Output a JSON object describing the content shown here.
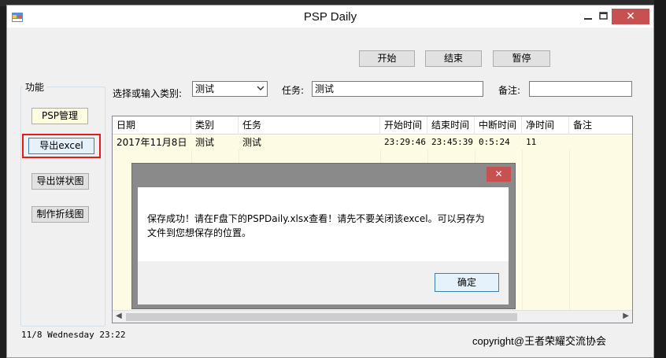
{
  "window": {
    "title": "PSP Daily",
    "close_glyph": "✕"
  },
  "toolbar": {
    "start": "开始",
    "end": "结束",
    "pause": "暂停"
  },
  "sidebar": {
    "group_title": "功能",
    "psp_manage": "PSP管理",
    "export_excel": "导出excel",
    "export_pie": "导出饼状图",
    "make_line": "制作折线图"
  },
  "form": {
    "category_label": "选择或输入类别:",
    "category_value": "测试",
    "task_label": "任务:",
    "task_value": "测试",
    "note_label": "备注:",
    "note_value": ""
  },
  "grid": {
    "columns": [
      "日期",
      "类别",
      "任务",
      "开始时间",
      "结束时间",
      "中断时间",
      "净时间",
      "备注"
    ],
    "rows": [
      [
        "2017年11月8日",
        "测试",
        "测试",
        "23:29:46",
        "23:45:39",
        "0:5:24",
        "11",
        ""
      ]
    ]
  },
  "status": {
    "datetime": "11/8  Wednesday 23:22",
    "copyright": "copyright@王者荣耀交流协会"
  },
  "dialog": {
    "close_glyph": "✕",
    "message": "保存成功！请在F盘下的PSPDaily.xlsx查看！请先不要关闭该excel。可以另存为文件到您想保存的位置。",
    "ok_label": "确定"
  },
  "colors": {
    "close_red": "#c75050",
    "highlight_red": "#e21c1c",
    "row_yellow": "#fdfbe3"
  },
  "icons": {
    "app": "window-app-icon",
    "minimize": "minimize-icon",
    "maximize": "maximize-icon",
    "close": "close-icon"
  }
}
